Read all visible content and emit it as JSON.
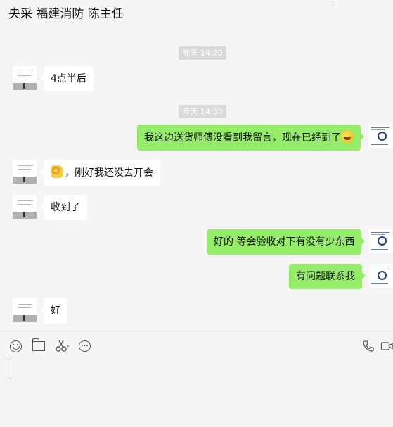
{
  "header": {
    "title": "央采 福建消防 陈主任"
  },
  "messages": [
    {
      "type": "time",
      "text": "昨天 14:20"
    },
    {
      "type": "in",
      "text": "4点半后"
    },
    {
      "type": "time",
      "text": "昨天 14:50"
    },
    {
      "type": "out",
      "text": "我这边送货师傅没看到我留言，现在已经到了",
      "emoji": "laughing-face-icon"
    },
    {
      "type": "in",
      "text": "，刚好我还没去开会",
      "emoji": "ok-hand-icon"
    },
    {
      "type": "in",
      "text": "收到了"
    },
    {
      "type": "out",
      "text": "好的 等会验收对下有没有少东西"
    },
    {
      "type": "out",
      "text": "有问题联系我"
    },
    {
      "type": "in",
      "text": "好"
    }
  ],
  "colors": {
    "outgoing_bubble": "#95ec69",
    "incoming_bubble": "#ffffff",
    "background": "#f5f5f5"
  },
  "toolbar": {
    "left_icons": [
      "emoji-icon",
      "folder-icon",
      "scissors-icon",
      "chat-bubble-icon"
    ],
    "right_icons": [
      "phone-icon",
      "video-icon"
    ]
  },
  "input": {
    "value": ""
  }
}
